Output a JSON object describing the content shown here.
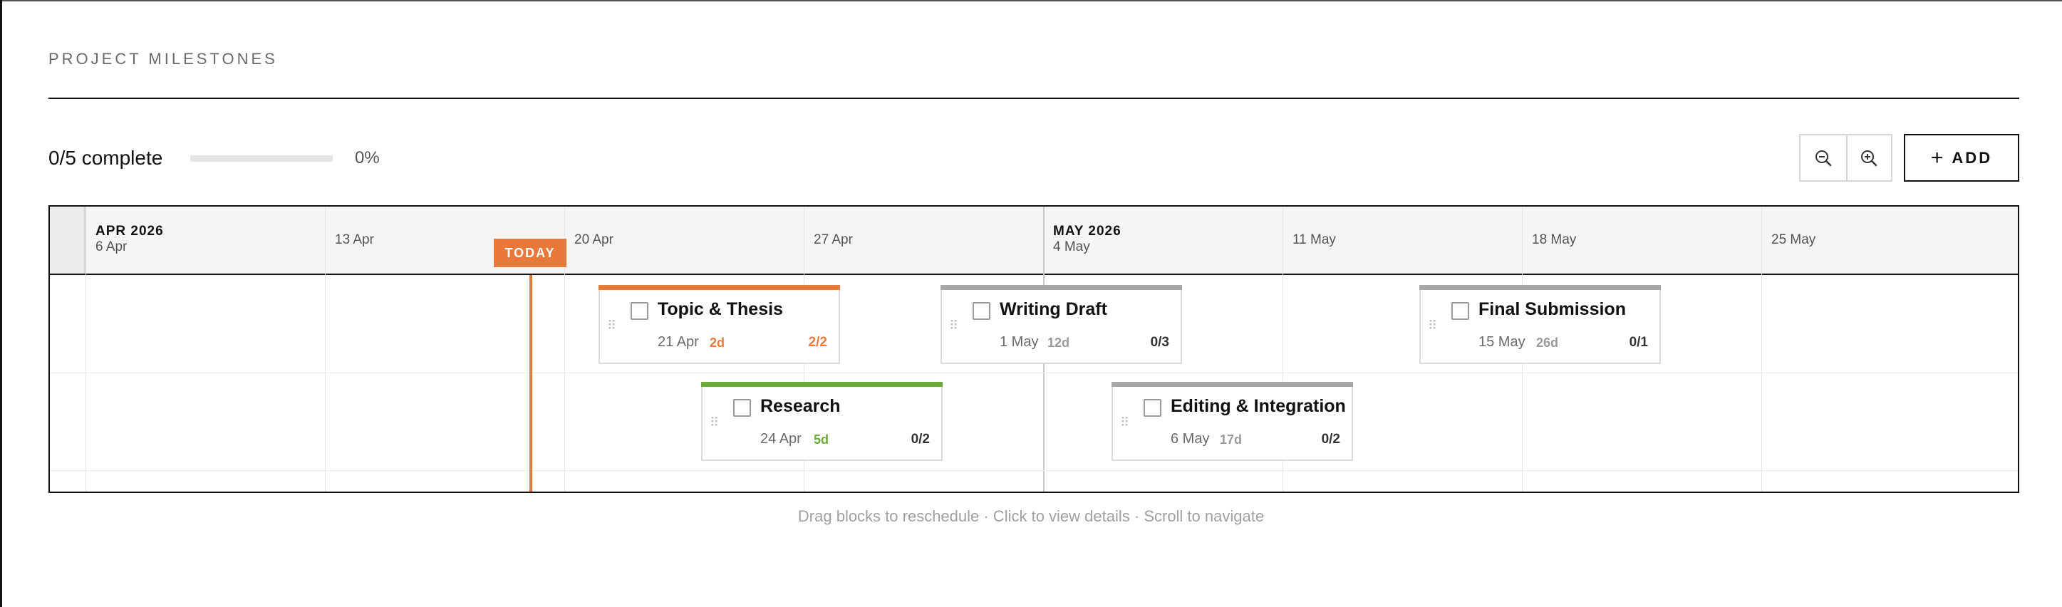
{
  "header": {
    "title": "PROJECT MILESTONES"
  },
  "progress": {
    "label": "0/5 complete",
    "percent_text": "0%",
    "fraction": 0
  },
  "toolbar": {
    "zoom_out_icon": "zoom-out-icon",
    "zoom_in_icon": "zoom-in-icon",
    "add_symbol": "+",
    "add_label": "ADD"
  },
  "timeline": {
    "months": [
      "APR 2026",
      "MAY 2026"
    ],
    "weeks": [
      "6 Apr",
      "13 Apr",
      "20 Apr",
      "27 Apr",
      "4 May",
      "11 May",
      "18 May",
      "25 May"
    ],
    "today_label": "TODAY"
  },
  "colors": {
    "accent": "#e8793a",
    "done_green": "#6aab3a",
    "neutral_bar": "#a8a8a8"
  },
  "milestones": [
    {
      "title": "Topic & Thesis",
      "date": "21 Apr",
      "days": "2d",
      "tasks": "2/2",
      "status_color": "#e8793a"
    },
    {
      "title": "Writing Draft",
      "date": "1 May",
      "days": "12d",
      "tasks": "0/3",
      "status_color": "#a8a8a8"
    },
    {
      "title": "Final Submission",
      "date": "15 May",
      "days": "26d",
      "tasks": "0/1",
      "status_color": "#a8a8a8"
    },
    {
      "title": "Research",
      "date": "24 Apr",
      "days": "5d",
      "tasks": "0/2",
      "status_color": "#6aab3a"
    },
    {
      "title": "Editing & Integration",
      "date": "6 May",
      "days": "17d",
      "tasks": "0/2",
      "status_color": "#a8a8a8"
    }
  ],
  "footer": {
    "hint": "Drag blocks to reschedule · Click to view details · Scroll to navigate"
  }
}
